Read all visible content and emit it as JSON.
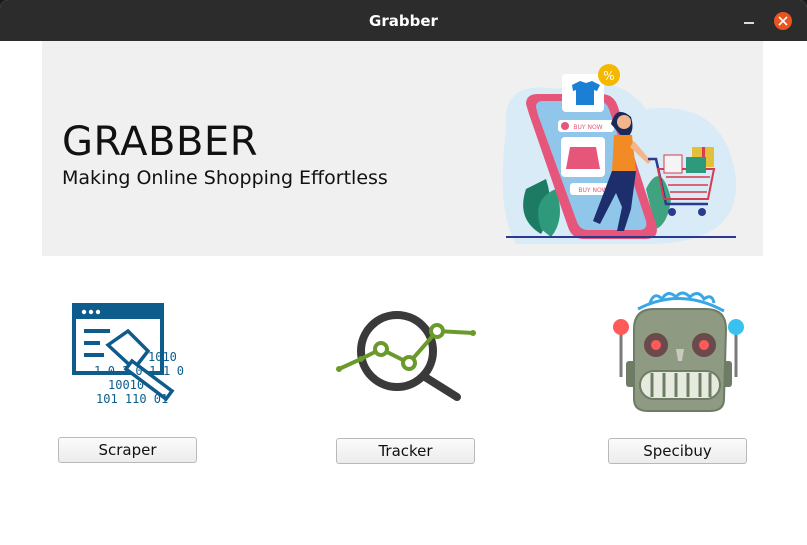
{
  "window": {
    "title": "Grabber"
  },
  "banner": {
    "title": "GRABBER",
    "subtitle": "Making Online Shopping Effortless",
    "illustration": {
      "buy_label_1": "BUY NOW",
      "buy_label_2": "BUY NOW",
      "badge": "%"
    }
  },
  "tools": {
    "scraper": {
      "label": "Scraper",
      "icon": "scraper-icon",
      "binary_lines": [
        "1010",
        "1010110",
        "10010",
        "101 110 01"
      ]
    },
    "tracker": {
      "label": "Tracker",
      "icon": "tracker-icon"
    },
    "specibuy": {
      "label": "Specibuy",
      "icon": "robot-icon"
    }
  },
  "colors": {
    "close_button": "#e95420",
    "titlebar": "#2c2c2c",
    "scraper_blue": "#0d5c8c",
    "tracker_green": "#6a9a2c",
    "robot_body": "#8e9a82"
  }
}
